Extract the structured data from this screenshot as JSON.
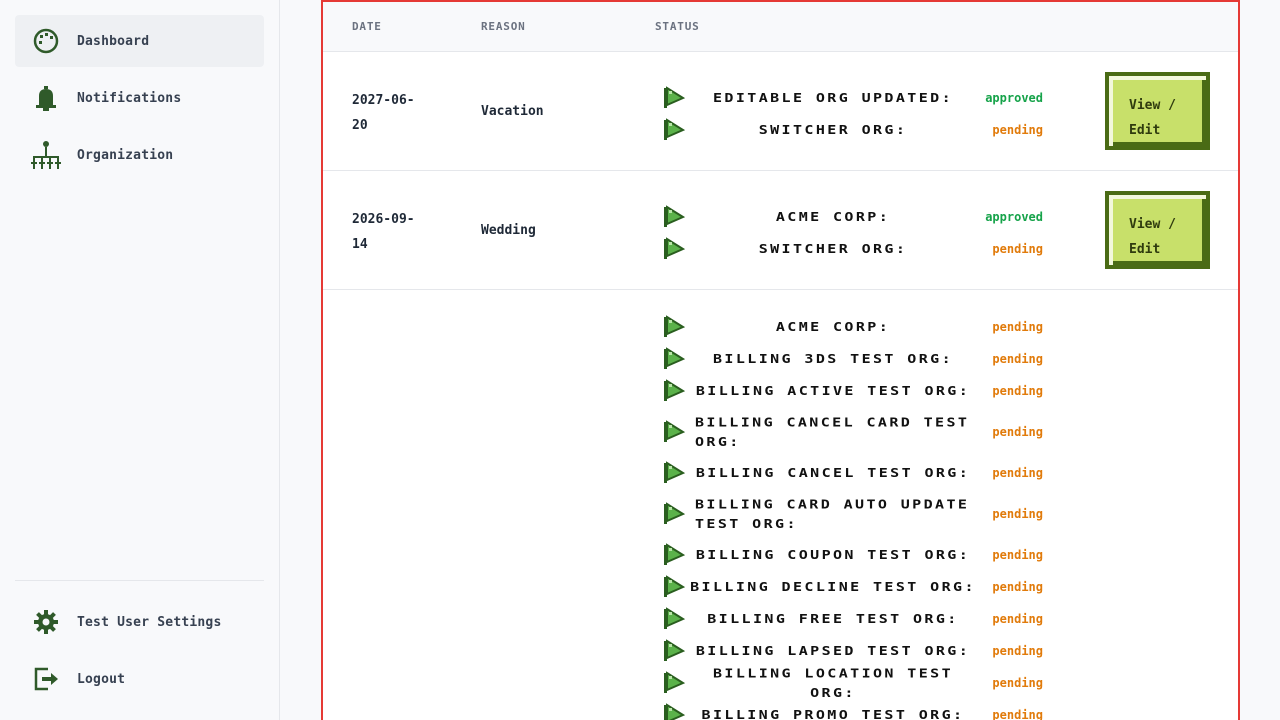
{
  "sidebar": {
    "nav": [
      {
        "label": "Dashboard",
        "icon": "palette-icon"
      },
      {
        "label": "Notifications",
        "icon": "bell-icon"
      },
      {
        "label": "Organization",
        "icon": "org-chart-icon"
      }
    ],
    "footer": [
      {
        "label": "Test User Settings",
        "icon": "gear-icon"
      },
      {
        "label": "Logout",
        "icon": "logout-icon"
      }
    ]
  },
  "table": {
    "headers": {
      "date": "DATE",
      "reason": "REASON",
      "status": "STATUS"
    },
    "button_label": "View / Edit",
    "rows": [
      {
        "date": "2027-06-20",
        "reason": "Vacation",
        "statuses": [
          {
            "org": "Editable Org Updated:",
            "state": "approved"
          },
          {
            "org": "Switcher Org:",
            "state": "pending"
          }
        ]
      },
      {
        "date": "2026-09-14",
        "reason": "Wedding",
        "statuses": [
          {
            "org": "Acme Corp:",
            "state": "approved"
          },
          {
            "org": "Switcher Org:",
            "state": "pending"
          }
        ]
      },
      {
        "date": "",
        "reason": "",
        "statuses": [
          {
            "org": "Acme Corp:",
            "state": "pending"
          },
          {
            "org": "Billing 3DS Test Org:",
            "state": "pending"
          },
          {
            "org": "Billing Active Test Org:",
            "state": "pending"
          },
          {
            "org": "Billing Cancel Card Test Org:",
            "state": "pending"
          },
          {
            "org": "Billing Cancel Test Org:",
            "state": "pending"
          },
          {
            "org": "Billing Card Auto Update Test Org:",
            "state": "pending"
          },
          {
            "org": "Billing Coupon Test Org:",
            "state": "pending"
          },
          {
            "org": "Billing Decline Test Org:",
            "state": "pending"
          },
          {
            "org": "Billing Free Test Org:",
            "state": "pending"
          },
          {
            "org": "Billing Lapsed Test Org:",
            "state": "pending"
          },
          {
            "org": "Billing Location Test Org:",
            "state": "pending"
          },
          {
            "org": "Billing Promo Test Org:",
            "state": "pending"
          }
        ]
      }
    ]
  },
  "colors": {
    "approved": "#16a34a",
    "pending": "#e17b0b",
    "accent": "#c8e06a",
    "icon": "#2f5a2a",
    "frame": "#e53935"
  }
}
